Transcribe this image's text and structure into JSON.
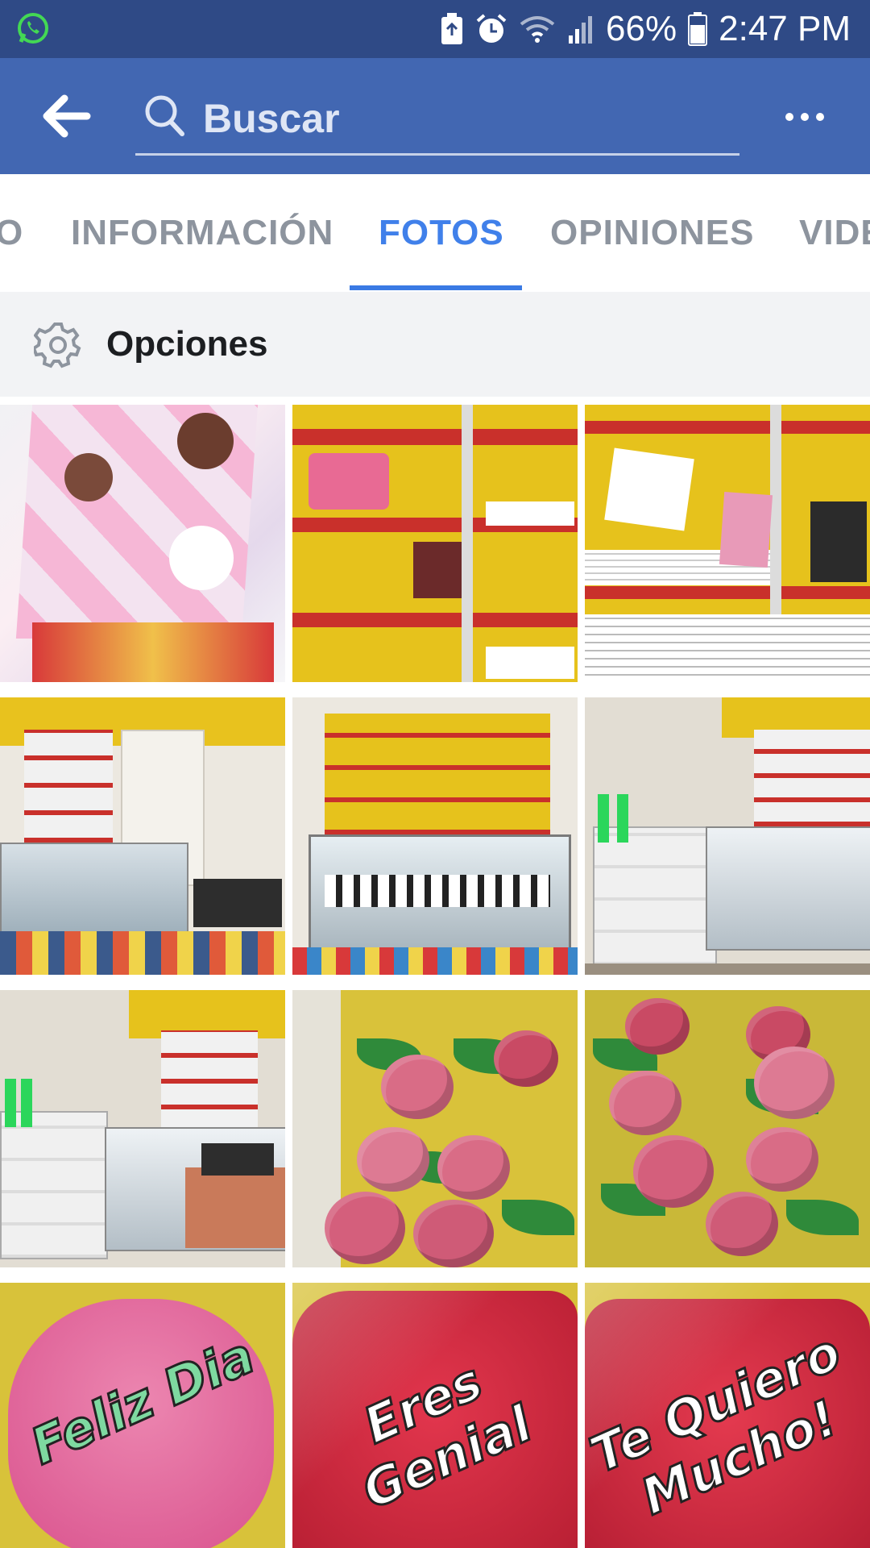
{
  "status_bar": {
    "battery": "66%",
    "time": "2:47 PM"
  },
  "app_bar": {
    "search_placeholder": "Buscar"
  },
  "tabs": [
    {
      "label": "O"
    },
    {
      "label": "INFORMACIÓN"
    },
    {
      "label": "FOTOS",
      "active": true
    },
    {
      "label": "OPINIONES"
    },
    {
      "label": "VIDE"
    }
  ],
  "options": {
    "label": "Opciones"
  },
  "photos": [
    {
      "subject": "doc-mcstuffins-gift-bags"
    },
    {
      "subject": "red-shelves-notebooks"
    },
    {
      "subject": "shelves-with-notebooks-sign"
    },
    {
      "subject": "shop-interior-door"
    },
    {
      "subject": "shop-display-counter"
    },
    {
      "subject": "shop-interior-racks"
    },
    {
      "subject": "shop-interior-corner"
    },
    {
      "subject": "pink-roses-arrangement"
    },
    {
      "subject": "pink-roses-vases"
    },
    {
      "subject": "pink-pillow",
      "caption": "Feliz Dia"
    },
    {
      "subject": "red-pillow",
      "caption": "Eres Genial"
    },
    {
      "subject": "red-pillow",
      "caption": "Te Quiero Mucho!"
    }
  ],
  "colors": {
    "status_bar": "#2f4a86",
    "app_bar": "#4267b2",
    "tab_active": "#4080ea",
    "tab_inactive": "#8d949e",
    "options_bg": "#f2f3f5"
  }
}
